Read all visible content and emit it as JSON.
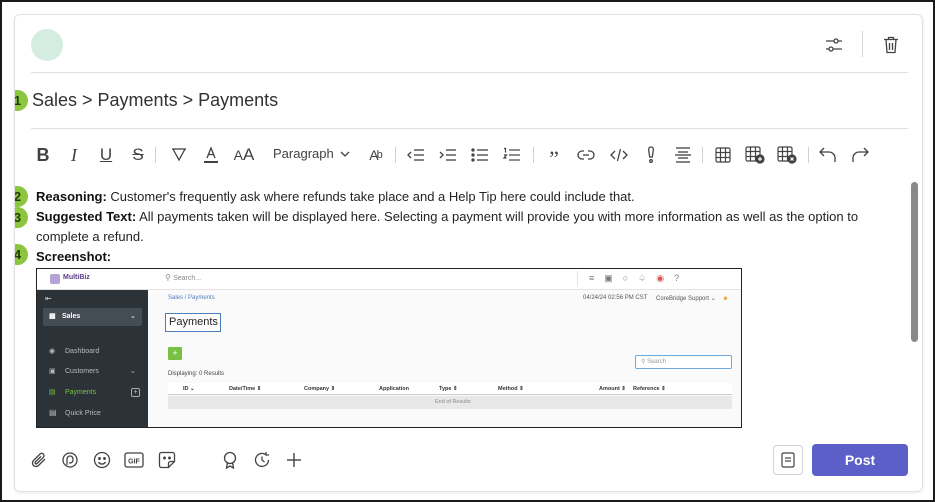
{
  "post": {
    "title": "Sales > Payments > Payments",
    "badges": [
      "1",
      "2",
      "3",
      "4"
    ],
    "reasoning_label": "Reasoning:",
    "reasoning_text": " Customer's frequently ask where refunds take place and a Help Tip here could include that.",
    "suggested_label": "Suggested Text:",
    "suggested_text": " All payments taken will be displayed here. Selecting a payment will provide you with more information as well as the option to complete a refund.",
    "screenshot_label": "Screenshot:"
  },
  "toolbar": {
    "paragraph_label": "Paragraph",
    "items": [
      "bold-icon",
      "italic-icon",
      "underline-icon",
      "strikethrough-icon",
      "highlight-icon",
      "font-color-icon",
      "font-size-icon",
      "paragraph-select",
      "clear-format-icon",
      "decrease-indent-icon",
      "increase-indent-icon",
      "bulleted-list-icon",
      "numbered-list-icon",
      "quote-icon",
      "link-icon",
      "code-icon",
      "important-icon",
      "align-icon",
      "table-icon",
      "insert-row-icon",
      "delete-table-icon",
      "undo-icon",
      "redo-icon"
    ]
  },
  "footer": {
    "post_label": "Post"
  },
  "embedded": {
    "logo_text": "MultiBiz",
    "search_placeholder": "Search...",
    "sidebar_title": "Sales",
    "nav": [
      "Dashboard",
      "Customers",
      "Payments",
      "Quick Price"
    ],
    "breadcrumb": "Sales / Payments",
    "datetime": "04/24/24 02:56 PM CST",
    "support_label": "CoreBridge Support",
    "page_title": "Payments",
    "add_label": "+",
    "search_label": "Search",
    "displaying": "Displaying: 0 Results",
    "columns": [
      "ID",
      "Date/Time",
      "Company",
      "Application",
      "Type",
      "Method",
      "Amount",
      "Reference"
    ],
    "end_text": "End of Results"
  },
  "colors": {
    "accent": "#5b5fc7",
    "badge": "#8cc63f",
    "avatar": "#d5ece1",
    "embedded_green": "#7ac143",
    "embedded_sidebar": "#2c3338"
  }
}
